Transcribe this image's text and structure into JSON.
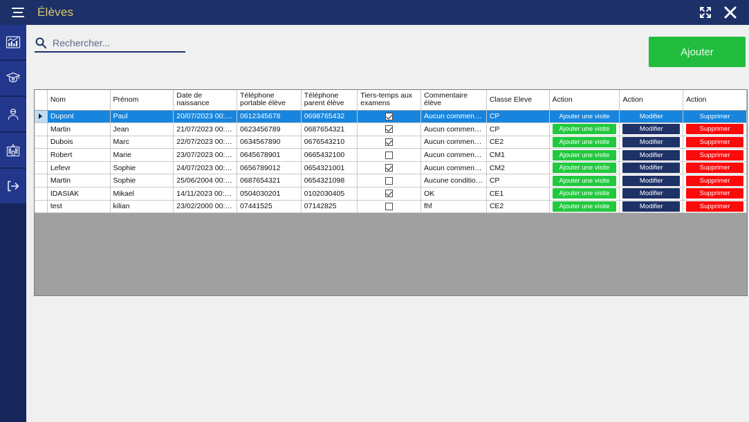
{
  "titlebar": {
    "title": "Élèves",
    "menu_icon": "hamburger-icon",
    "maximize_icon": "maximize-icon",
    "close_icon": "close-icon"
  },
  "sidebar": {
    "items": [
      {
        "icon": "chart-bar-icon",
        "name": "dashboard"
      },
      {
        "icon": "graduation-cap-icon",
        "name": "students"
      },
      {
        "icon": "teacher-icon",
        "name": "teachers"
      },
      {
        "icon": "school-building-icon",
        "name": "schools"
      },
      {
        "icon": "logout-icon",
        "name": "logout"
      }
    ]
  },
  "toolbar": {
    "search_placeholder": "Rechercher...",
    "search_value": "",
    "search_icon": "search-icon",
    "add_label": "Ajouter"
  },
  "grid": {
    "columns": [
      {
        "key": "sel",
        "label": "",
        "label2": ""
      },
      {
        "key": "nom",
        "label": "Nom",
        "label2": ""
      },
      {
        "key": "prenom",
        "label": "Prénom",
        "label2": ""
      },
      {
        "key": "naissance",
        "label": "Date de",
        "label2": "naissance"
      },
      {
        "key": "telEleve",
        "label": "Téléphone",
        "label2": "portable élève"
      },
      {
        "key": "telParent",
        "label": "Téléphone",
        "label2": "parent élève"
      },
      {
        "key": "tiers",
        "label": "Tiers-temps aux",
        "label2": "examens"
      },
      {
        "key": "comment",
        "label": "Commentaire",
        "label2": "élève"
      },
      {
        "key": "classe",
        "label": "Classe Eleve",
        "label2": ""
      },
      {
        "key": "act1",
        "label": "Action",
        "label2": ""
      },
      {
        "key": "act2",
        "label": "Action",
        "label2": ""
      },
      {
        "key": "act3",
        "label": "Action",
        "label2": ""
      }
    ],
    "buttons": {
      "visit": "Ajouter une visite",
      "edit": "Modifier",
      "delete": "Supprimer"
    },
    "rows": [
      {
        "nom": "Dupont",
        "prenom": "Paul",
        "naissance": "20/07/2023 00:00...",
        "telEleve": "0612345678",
        "telParent": "0698765432",
        "tiers": true,
        "comment": "Aucun commentaire",
        "classe": "CP",
        "selected": true
      },
      {
        "nom": "Martin",
        "prenom": "Jean",
        "naissance": "21/07/2023 00:00...",
        "telEleve": "0623456789",
        "telParent": "0687654321",
        "tiers": true,
        "comment": "Aucun commentaire",
        "classe": "CP",
        "selected": false
      },
      {
        "nom": "Dubois",
        "prenom": "Marc",
        "naissance": "22/07/2023 00:00...",
        "telEleve": "0634567890",
        "telParent": "0676543210",
        "tiers": true,
        "comment": "Aucun commentaire",
        "classe": "CE2",
        "selected": false
      },
      {
        "nom": "Robert",
        "prenom": "Marie",
        "naissance": "23/07/2023 00:00...",
        "telEleve": "0645678901",
        "telParent": "0665432100",
        "tiers": false,
        "comment": "Aucun commentaire",
        "classe": "CM1",
        "selected": false
      },
      {
        "nom": "Lefevr",
        "prenom": "Sophie",
        "naissance": "24/07/2023 00:00...",
        "telEleve": "0656789012",
        "telParent": "0654321001",
        "tiers": true,
        "comment": "Aucun commentaire",
        "classe": "CM2",
        "selected": false
      },
      {
        "nom": "Martin",
        "prenom": "Sophie",
        "naissance": "25/06/2004 00:00...",
        "telEleve": "0687654321",
        "telParent": "0654321098",
        "tiers": false,
        "comment": "Aucune condition ...",
        "classe": "CP",
        "selected": false
      },
      {
        "nom": "IDASIAK",
        "prenom": "Mikael",
        "naissance": "14/11/2023 00:00...",
        "telEleve": "0504030201",
        "telParent": "0102030405",
        "tiers": true,
        "comment": "OK",
        "classe": "CE1",
        "selected": false
      },
      {
        "nom": "test",
        "prenom": "kilian",
        "naissance": "23/02/2000 00:00...",
        "telEleve": "07441525",
        "telParent": "07142825",
        "tiers": false,
        "comment": "fhf",
        "classe": "CE2",
        "selected": false
      }
    ]
  },
  "colors": {
    "titlebar": "#1D3068",
    "title_text": "#D9C96B",
    "sidebar_item": "#22378C",
    "sidebar_bg": "#16255A",
    "accent_green": "#22BD3E",
    "selection_blue": "#1785DE",
    "button_edit": "#1F3268",
    "button_delete": "#FB0A0A",
    "grid_empty": "#A0A0A0"
  }
}
